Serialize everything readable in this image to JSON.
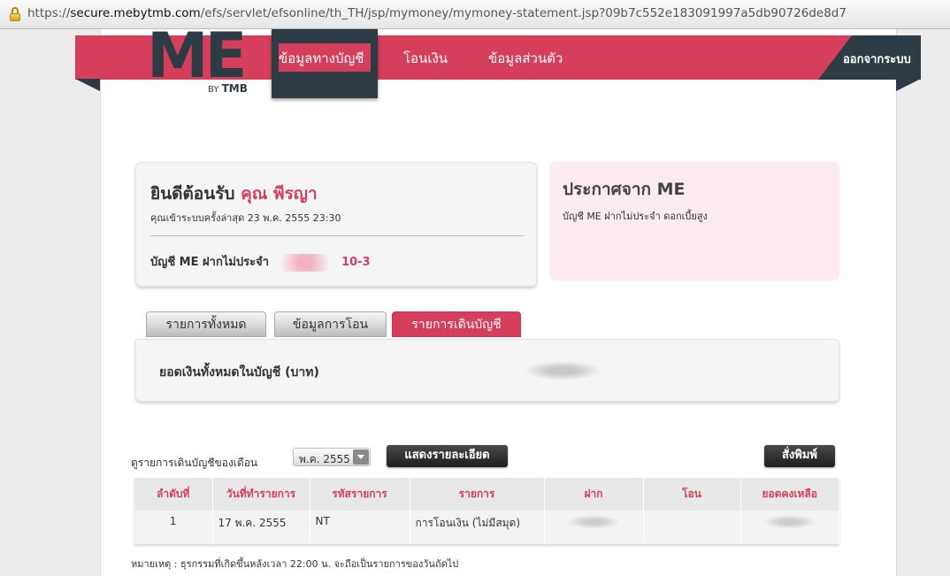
{
  "browser": {
    "url_scheme": "https://",
    "url_host": "secure.mebytmb.com",
    "url_path": "/efs/servlet/efsonline/th_TH/jsp/mymoney/mymoney-statement.jsp?09b7c552e183091997a5db90726de8d7"
  },
  "logo": {
    "mark": "ME",
    "by": "BY",
    "brand": "TMB"
  },
  "nav": {
    "items": [
      {
        "label": "ข้อมูลทางบัญชี",
        "active": true
      },
      {
        "label": "โอนเงิน",
        "active": false
      },
      {
        "label": "ข้อมูลส่วนตัว",
        "active": false
      }
    ],
    "logout": "ออกจากระบบ"
  },
  "welcome": {
    "greeting": "ยินดีต้อนรับ",
    "name": "คุณ พีรญา",
    "last_login": "คุณเข้าระบบครั้งล่าสุด 23 พ.ค. 2555 23:30",
    "account_label": "บัญชี ME ฝากไม่ประจำ",
    "account_suffix": "10-3"
  },
  "notice": {
    "title": "ประกาศจาก ME",
    "body": "บัญชี ME ฝากไม่ประจำ ดอกเบี้ยสูง"
  },
  "tabs": [
    {
      "label": "รายการทั้งหมด",
      "active": false
    },
    {
      "label": "ข้อมูลการโอน",
      "active": false
    },
    {
      "label": "รายการเดินบัญชี",
      "active": true
    }
  ],
  "balance": {
    "label": "ยอดเงินทั้งหมดในบัญชี (บาท)"
  },
  "statement": {
    "month_label": "ดูรายการเดินบัญชีของเดือน",
    "month_value": "พ.ค. 2555",
    "show_button": "แสดงรายละเอียด",
    "print_button": "สั่งพิมพ์",
    "columns": [
      "ลำดับที่",
      "วันที่ทำรายการ",
      "รหัสรายการ",
      "รายการ",
      "ฝาก",
      "โอน",
      "ยอดคงเหลือ"
    ],
    "rows": [
      {
        "no": "1",
        "date": "17 พ.ค. 2555",
        "code": "NT",
        "desc": "การโอนเงิน (ไม่มีสมุด)",
        "deposit": "",
        "transfer": "",
        "balance": ""
      }
    ],
    "remark": "หมายเหตุ : ธุรกรรมที่เกิดขึ้นหลังเวลา 22:00 น. จะถือเป็นรายการของวันถัดไป"
  },
  "colors": {
    "brand_pink": "#d53f5c",
    "brand_dark": "#2d3b45"
  }
}
